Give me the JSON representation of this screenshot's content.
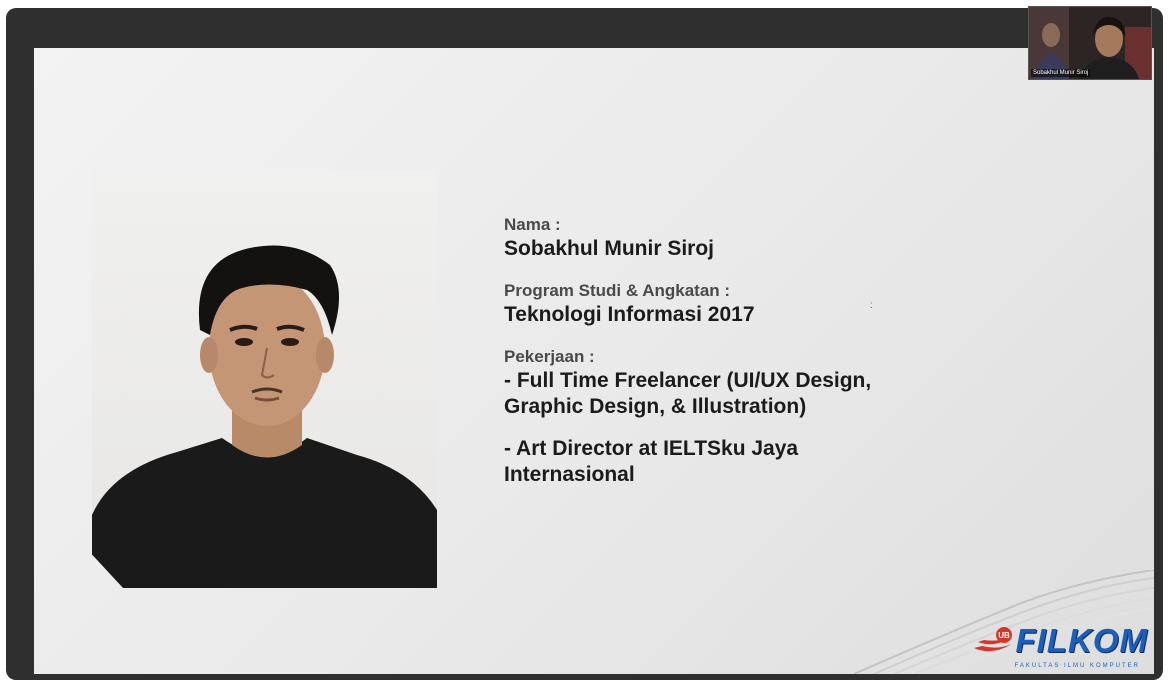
{
  "presenter": {
    "camera_name": "Sobakhul Munir Siroj"
  },
  "slide": {
    "name_label": "Nama :",
    "name_value": "Sobakhul Munir Siroj",
    "study_label": "Program Studi & Angkatan :",
    "study_value": "Teknologi Informasi 2017",
    "job_label": "Pekerjaan :",
    "jobs": [
      "- Full Time Freelancer (UI/UX Design,\nGraphic Design, & Illustration)",
      "- Art Director at IELTSku Jaya\nInternasional"
    ],
    "stray_mark": ":"
  },
  "logo": {
    "badge": "UB",
    "text": "FILKOM",
    "subtitle": "FAKULTAS ILMU KOMPUTER",
    "colors": {
      "blue": "#1d5fb8",
      "red": "#d8352a"
    }
  },
  "colors": {
    "frame": "#2f2f2f",
    "slide_bg": "#ececec",
    "text": "#1b1b1b"
  }
}
